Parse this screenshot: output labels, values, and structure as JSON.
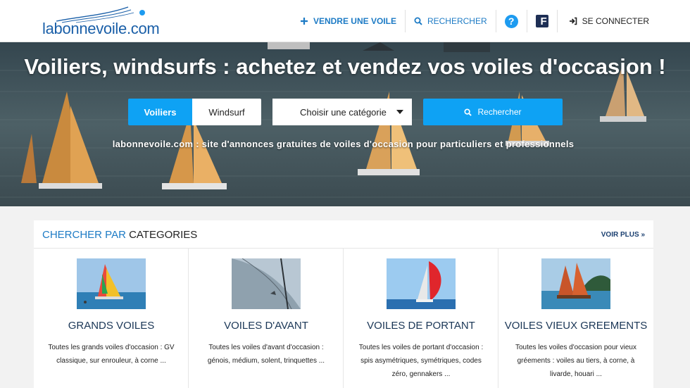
{
  "header": {
    "logo_text": "labonnevoile.com",
    "nav": {
      "sell_label": "VENDRE UNE VOILE",
      "search_label": "RECHERCHER",
      "help_glyph": "?",
      "facebook_glyph": "f",
      "login_label": "SE CONNECTER"
    }
  },
  "hero": {
    "title": "Voiliers, windsurfs : achetez et vendez vos voiles d'occasion !",
    "tabs": [
      {
        "label": "Voiliers",
        "active": true
      },
      {
        "label": "Windsurf",
        "active": false
      }
    ],
    "category_select": {
      "value": "Choisir une catégorie"
    },
    "search_button": "Rechercher",
    "subtitle": "labonnevoile.com : site d'annonces gratuites de voiles d'occasion pour particuliers et professionnels"
  },
  "categories": {
    "title_accent": "CHERCHER PAR",
    "title_rest": " CATEGORIES",
    "voir_plus": "VOIR PLUS",
    "items": [
      {
        "title": "GRANDS VOILES",
        "desc": "Toutes les grands voiles d'occasion : GV classique, sur enrouleur, à corne ..."
      },
      {
        "title": "VOILES D'AVANT",
        "desc": "Toutes les voiles d'avant d'occasion : génois, médium, solent, trinquettes ..."
      },
      {
        "title": "VOILES DE PORTANT",
        "desc": "Toutes les voiles de portant d'occasion : spis asymétriques, symétriques, codes zéro, gennakers ..."
      },
      {
        "title": "VOILES VIEUX GREEMENTS",
        "desc": "Toutes les voiles d'occasion pour vieux gréements : voiles au tiers, à corne, à livarde, houari ..."
      }
    ]
  },
  "colors": {
    "accent": "#0ea2f4",
    "brand_blue": "#1d7bc5",
    "navy": "#1a3656"
  }
}
